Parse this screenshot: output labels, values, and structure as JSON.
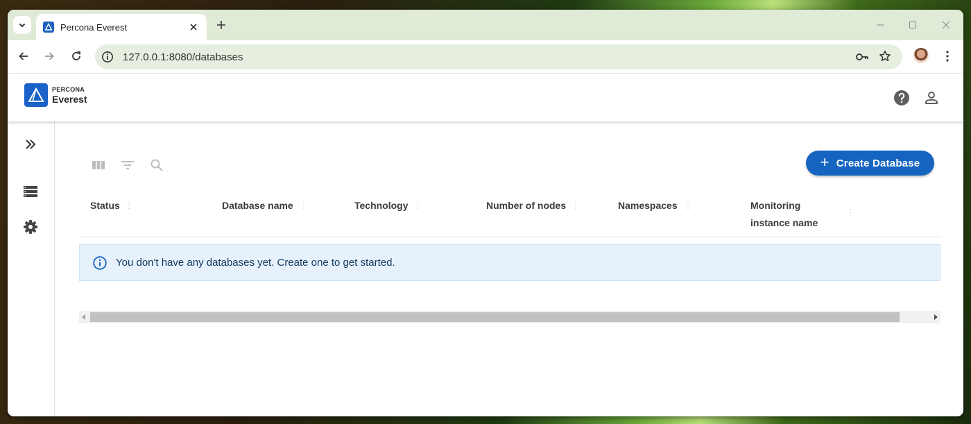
{
  "browser": {
    "tab_title": "Percona Everest",
    "url": "127.0.0.1:8080/databases"
  },
  "brand": {
    "line1": "PERCONA",
    "line2": "Everest",
    "color": "#1a62c9"
  },
  "sidebar": {
    "items": [
      {
        "icon": "chevron-double-right-icon"
      },
      {
        "icon": "storage-list-icon"
      },
      {
        "icon": "gear-icon"
      }
    ]
  },
  "toolbar": {
    "icons": [
      "columns-icon",
      "filter-icon",
      "search-icon"
    ],
    "create_label": "Create Database",
    "create_color": "#1565c0"
  },
  "table": {
    "columns": [
      {
        "label": "Status"
      },
      {
        "label": "Database name"
      },
      {
        "label": "Technology"
      },
      {
        "label": "Number of nodes"
      },
      {
        "label": "Namespaces"
      },
      {
        "label": "Monitoring",
        "label2": "instance name"
      }
    ],
    "empty_message": "You don't have any databases yet. Create one to get started."
  }
}
